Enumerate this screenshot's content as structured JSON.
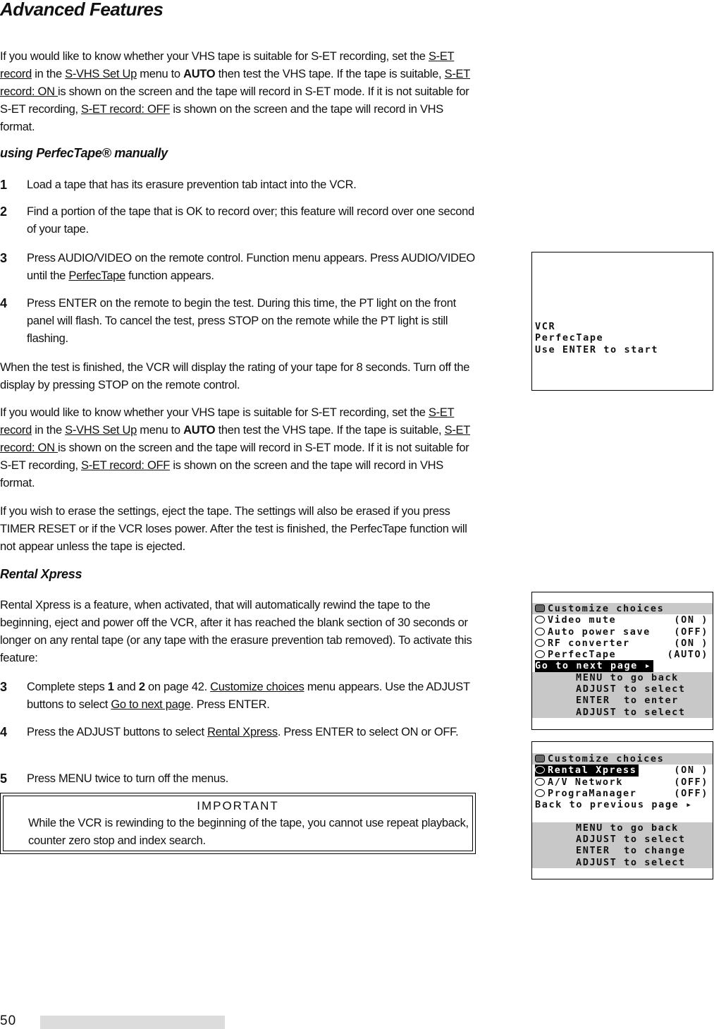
{
  "title": "Advanced Features",
  "p1": {
    "a": "If you would like to know whether your VHS tape is suitable for S-ET recording, set the ",
    "u1": "S-ET record",
    "b": " in the ",
    "u2": "S-VHS Set Up",
    "c": " menu to ",
    "k": "AUTO",
    "d": " then test the VHS tape.  If the tape is suitable, ",
    "u3": "S-ET record: ON ",
    "e": " is shown on the screen and the tape will record in S-ET mode.  If it is not suitable for S-ET recording, ",
    "u4": "S-ET record: OFF",
    "f": " is shown on the screen and the tape will record in VHS format."
  },
  "sub1": "using PerfecTape® manually",
  "steps1": [
    {
      "n": "1",
      "text": "Load a tape that has its erasure prevention tab intact into the VCR."
    },
    {
      "n": "2",
      "text": "Find a portion of the tape that is OK to record over; this feature will record over one second of your tape."
    },
    {
      "n": "3",
      "a": "Press AUDIO/VIDEO  on the remote control.  Function menu appears. Press AUDIO/VIDEO  until the ",
      "u": "PerfecTape",
      "b": " function appears."
    },
    {
      "n": "4",
      "text": "Press ENTER on the remote to begin the test.  During this time, the PT light on the front panel will flash. To cancel the test, press STOP on the remote while the PT light is still flashing."
    }
  ],
  "p2": "When the test is finished, the VCR will display the rating of your tape for 8 seconds. Turn off the display by pressing STOP on the remote control.",
  "p4": "If you wish to erase the settings, eject the tape. The settings will also be erased if you press TIMER RESET or if the VCR loses power. After the test is finished, the PerfecTape function will not appear unless the tape is ejected.",
  "sub2": "Rental Xpress",
  "p5": "Rental Xpress is a feature, when activated, that will automatically rewind the tape to the beginning, eject and power off the VCR, after it has reached the blank section of 30 seconds or longer on any rental tape (or any tape with the erasure prevention tab removed). To activate this feature:",
  "steps2": [
    {
      "n": "3",
      "a": "Complete steps ",
      "k1": "1",
      "b": " and ",
      "k2": "2",
      "c": " on page 42.  ",
      "u1": "Customize choices",
      "d": " menu appears. Use the ADJUST buttons to select ",
      "u2": "Go to next page",
      "e": ".  Press ENTER."
    },
    {
      "n": "4",
      "a": "Press the ADJUST buttons to select ",
      "u": "Rental Xpress",
      "b": ".  Press ENTER to select ON or OFF."
    },
    {
      "n": "5",
      "text": "Press MENU twice to turn off the menus."
    }
  ],
  "important": {
    "title": "IMPORTANT",
    "text": "While the VCR is rewinding to the beginning of the tape, you cannot use repeat playback, counter zero stop and index search."
  },
  "screen1": [
    "VCR",
    "PerfecTape",
    "Use ENTER to start"
  ],
  "screen2": {
    "header": "Customize choices",
    "items": [
      {
        "label": "Video mute",
        "value": "(ON )"
      },
      {
        "label": "Auto power save",
        "value": "(OFF)"
      },
      {
        "label": "RF converter",
        "value": "(ON )"
      },
      {
        "label": "PerfecTape",
        "value": "(AUTO)"
      }
    ],
    "nav": "Go to next page ▸",
    "help": [
      "MENU to go back",
      "ADJUST to select",
      "ENTER  to enter",
      "ADJUST to select"
    ]
  },
  "screen3": {
    "header": "Customize choices",
    "items": [
      {
        "label": "Rental Xpress",
        "value": "(ON )"
      },
      {
        "label": "A/V Network",
        "value": "(OFF)"
      },
      {
        "label": "PrograManager",
        "value": "(OFF)"
      }
    ],
    "nav": "Back to previous page ▸",
    "help": [
      "MENU to go back",
      "ADJUST to select",
      "ENTER  to change",
      "ADJUST to select"
    ]
  },
  "page_number": "50"
}
